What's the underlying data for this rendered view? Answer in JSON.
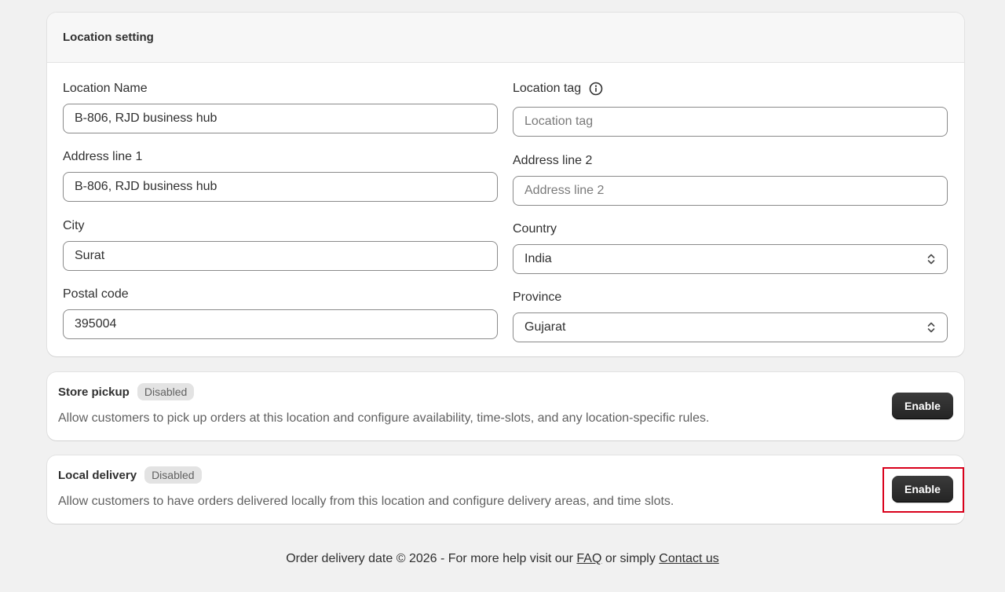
{
  "location_card": {
    "title": "Location setting",
    "fields": {
      "location_name": {
        "label": "Location Name",
        "value": "B-806, RJD business hub"
      },
      "location_tag": {
        "label": "Location tag",
        "value": "",
        "placeholder": "Location tag"
      },
      "address1": {
        "label": "Address line 1",
        "value": "B-806, RJD business hub"
      },
      "address2": {
        "label": "Address line 2",
        "value": "",
        "placeholder": "Address line 2"
      },
      "city": {
        "label": "City",
        "value": "Surat"
      },
      "country": {
        "label": "Country",
        "value": "India"
      },
      "postal": {
        "label": "Postal code",
        "value": "395004"
      },
      "province": {
        "label": "Province",
        "value": "Gujarat"
      }
    }
  },
  "store_pickup": {
    "title": "Store pickup",
    "badge": "Disabled",
    "description": "Allow customers to pick up orders at this location and configure availability, time-slots, and any location-specific rules.",
    "button": "Enable"
  },
  "local_delivery": {
    "title": "Local delivery",
    "badge": "Disabled",
    "description": "Allow customers to have orders delivered locally from this location and configure delivery areas, and time slots.",
    "button": "Enable"
  },
  "footer": {
    "prefix": "Order delivery date © 2026 - For more help visit our ",
    "faq": "FAQ",
    "middle": " or simply ",
    "contact": "Contact us"
  },
  "colors": {
    "background": "#f1f1f1",
    "button": "#303030",
    "highlight": "#d9001b"
  }
}
